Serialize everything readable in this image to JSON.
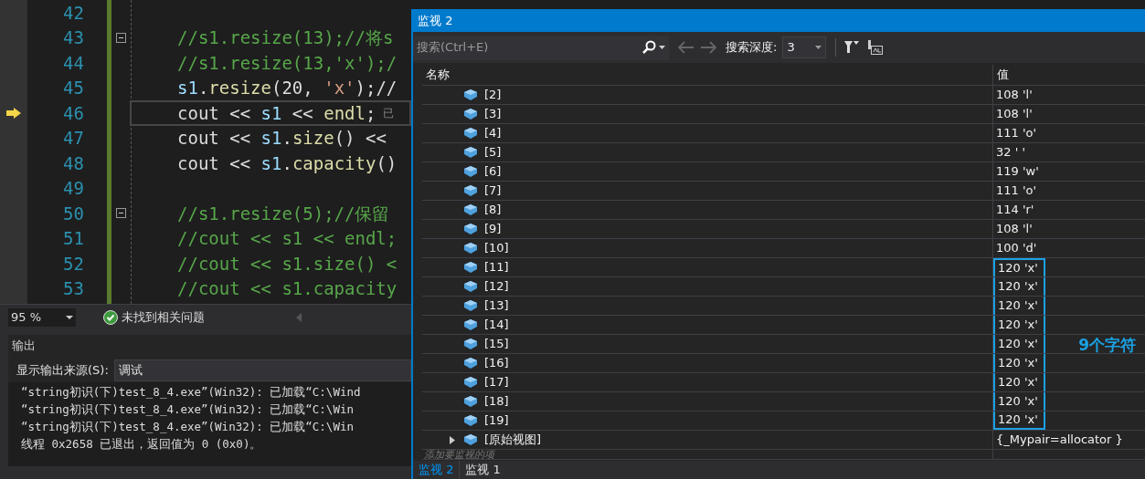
{
  "editor": {
    "lines": [
      {
        "number": "42"
      },
      {
        "number": "43",
        "fold": true,
        "tokens": [
          {
            "text": "//s1.resize(13);//将s",
            "kind": "comment"
          }
        ]
      },
      {
        "number": "44",
        "tokens": [
          {
            "text": "//s1.resize(13,'x');/",
            "kind": "comment"
          }
        ]
      },
      {
        "number": "45",
        "tokens": [
          {
            "text": "s1",
            "kind": "var"
          },
          {
            "text": ".",
            "kind": "plain"
          },
          {
            "text": "resize",
            "kind": "func"
          },
          {
            "text": "(20, ",
            "kind": "plain"
          },
          {
            "text": "'x'",
            "kind": "str"
          },
          {
            "text": ");//",
            "kind": "plain"
          }
        ]
      },
      {
        "number": "46",
        "current": true,
        "hint": "已",
        "tokens": [
          {
            "text": "cout",
            "kind": "plain"
          },
          {
            "text": " << ",
            "kind": "plain"
          },
          {
            "text": "s1",
            "kind": "var"
          },
          {
            "text": " << ",
            "kind": "plain"
          },
          {
            "text": "endl",
            "kind": "func"
          },
          {
            "text": ";",
            "kind": "plain"
          }
        ]
      },
      {
        "number": "47",
        "tokens": [
          {
            "text": "cout",
            "kind": "plain"
          },
          {
            "text": " << ",
            "kind": "plain"
          },
          {
            "text": "s1",
            "kind": "var"
          },
          {
            "text": ".",
            "kind": "plain"
          },
          {
            "text": "size",
            "kind": "func"
          },
          {
            "text": "() <<",
            "kind": "plain"
          }
        ]
      },
      {
        "number": "48",
        "tokens": [
          {
            "text": "cout",
            "kind": "plain"
          },
          {
            "text": " << ",
            "kind": "plain"
          },
          {
            "text": "s1",
            "kind": "var"
          },
          {
            "text": ".",
            "kind": "plain"
          },
          {
            "text": "capacity",
            "kind": "func"
          },
          {
            "text": "()",
            "kind": "plain"
          }
        ]
      },
      {
        "number": "49"
      },
      {
        "number": "50",
        "fold": true,
        "tokens": [
          {
            "text": "//s1.resize(5);//保留",
            "kind": "comment"
          }
        ]
      },
      {
        "number": "51",
        "tokens": [
          {
            "text": "//cout << s1 << endl;",
            "kind": "comment"
          }
        ]
      },
      {
        "number": "52",
        "tokens": [
          {
            "text": "//cout << s1.size() <",
            "kind": "comment"
          }
        ]
      },
      {
        "number": "53",
        "tokens": [
          {
            "text": "//cout << s1.capacity",
            "kind": "comment"
          }
        ]
      }
    ]
  },
  "status_bar": {
    "zoom": "95 %",
    "issues": "未找到相关问题"
  },
  "output": {
    "title": "输出",
    "source_label": "显示输出来源(S):",
    "source_value": "调试",
    "lines": [
      "“string初识(下)test_8_4.exe”(Win32): 已加载“C:\\Wind",
      "“string初识(下)test_8_4.exe”(Win32): 已加载“C:\\Win",
      "“string初识(下)test_8_4.exe”(Win32): 已加载“C:\\Win",
      "线程 0x2658 已退出，返回值为 0 (0x0)。"
    ]
  },
  "watch": {
    "title": "监视 2",
    "search_placeholder": "搜索(Ctrl+E)",
    "depth_label": "搜索深度:",
    "depth_value": "3",
    "columns": [
      "名称",
      "值"
    ],
    "items": [
      {
        "kind": "element",
        "name": "[2]",
        "value": "108 'l'",
        "highlighted": false
      },
      {
        "kind": "element",
        "name": "[3]",
        "value": "108 'l'",
        "highlighted": false
      },
      {
        "kind": "element",
        "name": "[4]",
        "value": "111 'o'",
        "highlighted": false
      },
      {
        "kind": "element",
        "name": "[5]",
        "value": "32 ' '",
        "highlighted": false
      },
      {
        "kind": "element",
        "name": "[6]",
        "value": "119 'w'",
        "highlighted": false
      },
      {
        "kind": "element",
        "name": "[7]",
        "value": "111 'o'",
        "highlighted": false
      },
      {
        "kind": "element",
        "name": "[8]",
        "value": "114 'r'",
        "highlighted": false
      },
      {
        "kind": "element",
        "name": "[9]",
        "value": "108 'l'",
        "highlighted": false
      },
      {
        "kind": "element",
        "name": "[10]",
        "value": "100 'd'",
        "highlighted": false
      },
      {
        "kind": "element",
        "name": "[11]",
        "value": "120 'x'",
        "highlighted": true
      },
      {
        "kind": "element",
        "name": "[12]",
        "value": "120 'x'",
        "highlighted": true
      },
      {
        "kind": "element",
        "name": "[13]",
        "value": "120 'x'",
        "highlighted": true
      },
      {
        "kind": "element",
        "name": "[14]",
        "value": "120 'x'",
        "highlighted": true
      },
      {
        "kind": "element",
        "name": "[15]",
        "value": "120 'x'",
        "highlighted": true
      },
      {
        "kind": "element",
        "name": "[16]",
        "value": "120 'x'",
        "highlighted": true
      },
      {
        "kind": "element",
        "name": "[17]",
        "value": "120 'x'",
        "highlighted": true
      },
      {
        "kind": "element",
        "name": "[18]",
        "value": "120 'x'",
        "highlighted": true
      },
      {
        "kind": "element",
        "name": "[19]",
        "value": "120 'x'",
        "highlighted": true
      },
      {
        "kind": "raw_view",
        "name": "[原始视图]",
        "value": "{_Mypair=allocator }",
        "highlighted": false,
        "expanded": false
      }
    ],
    "add_item_placeholder": "添加要监视的项",
    "annotation": "9个字符",
    "tabs": [
      {
        "label": "监视 2",
        "selected": true
      },
      {
        "label": "监视 1",
        "selected": false
      }
    ]
  }
}
